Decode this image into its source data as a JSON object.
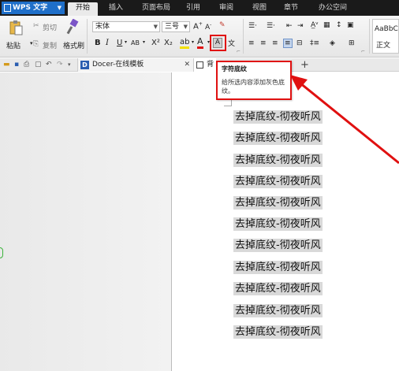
{
  "app": {
    "name": "WPS 文字"
  },
  "menu": {
    "tabs": [
      "开始",
      "插入",
      "页面布局",
      "引用",
      "审阅",
      "视图",
      "章节",
      "办公空间"
    ]
  },
  "ribbon": {
    "paste": "粘贴",
    "cut": "剪切",
    "copy": "复制",
    "format_painter": "格式刷",
    "font_name": "宋体",
    "font_size": "三号",
    "style_sample": "AaBbC",
    "style_name": "正文"
  },
  "tabs": {
    "docer": "Docer-在线模板",
    "current_doc": "背"
  },
  "tooltip": {
    "title": "字符底纹",
    "text": "给所选内容添加灰色底纹。"
  },
  "document": {
    "lines": [
      "去掉底纹-彻夜听风",
      "去掉底纹-彻夜听风",
      "去掉底纹-彻夜听风",
      "去掉底纹-彻夜听风",
      "去掉底纹-彻夜听风",
      "去掉底纹-彻夜听风",
      "去掉底纹-彻夜听风",
      "去掉底纹-彻夜听风",
      "去掉底纹-彻夜听风",
      "去掉底纹-彻夜听风",
      "去掉底纹-彻夜听风"
    ]
  },
  "colors": {
    "accent": "#1f6fc9",
    "annotation": "#e01010",
    "shading": "#d9d9d9"
  }
}
